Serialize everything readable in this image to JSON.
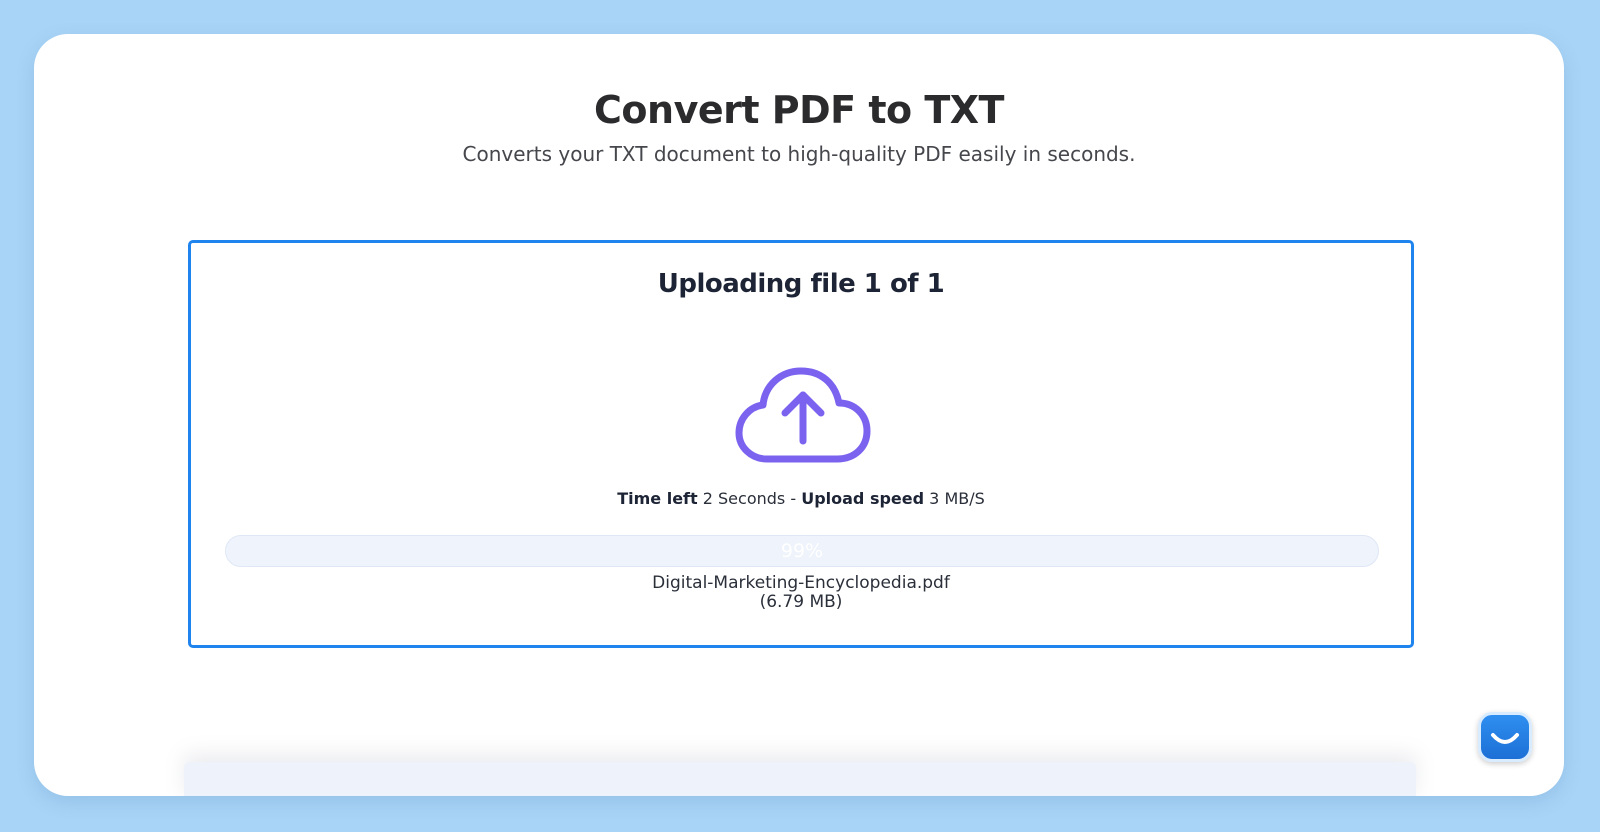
{
  "page": {
    "title": "Convert PDF to TXT",
    "subtitle": "Converts your TXT document to high-quality PDF easily in seconds."
  },
  "upload": {
    "heading": "Uploading file 1 of 1",
    "icon": "cloud-upload-icon",
    "time_left_label": "Time left",
    "time_left_value": "2 Seconds",
    "separator": "-",
    "speed_label": "Upload speed",
    "speed_value": "3 MB/S",
    "progress_percent": 99,
    "progress_label": "99%",
    "file_name": "Digital-Marketing-Encyclopedia.pdf",
    "file_size": "(6.79 MB)"
  },
  "chat_widget": {
    "icon": "chat-smile-icon"
  },
  "colors": {
    "background": "#a8d4f7",
    "accent_border": "#1f84ee",
    "icon_purple": "#7b63f0",
    "progress_track": "#eef3fc"
  }
}
